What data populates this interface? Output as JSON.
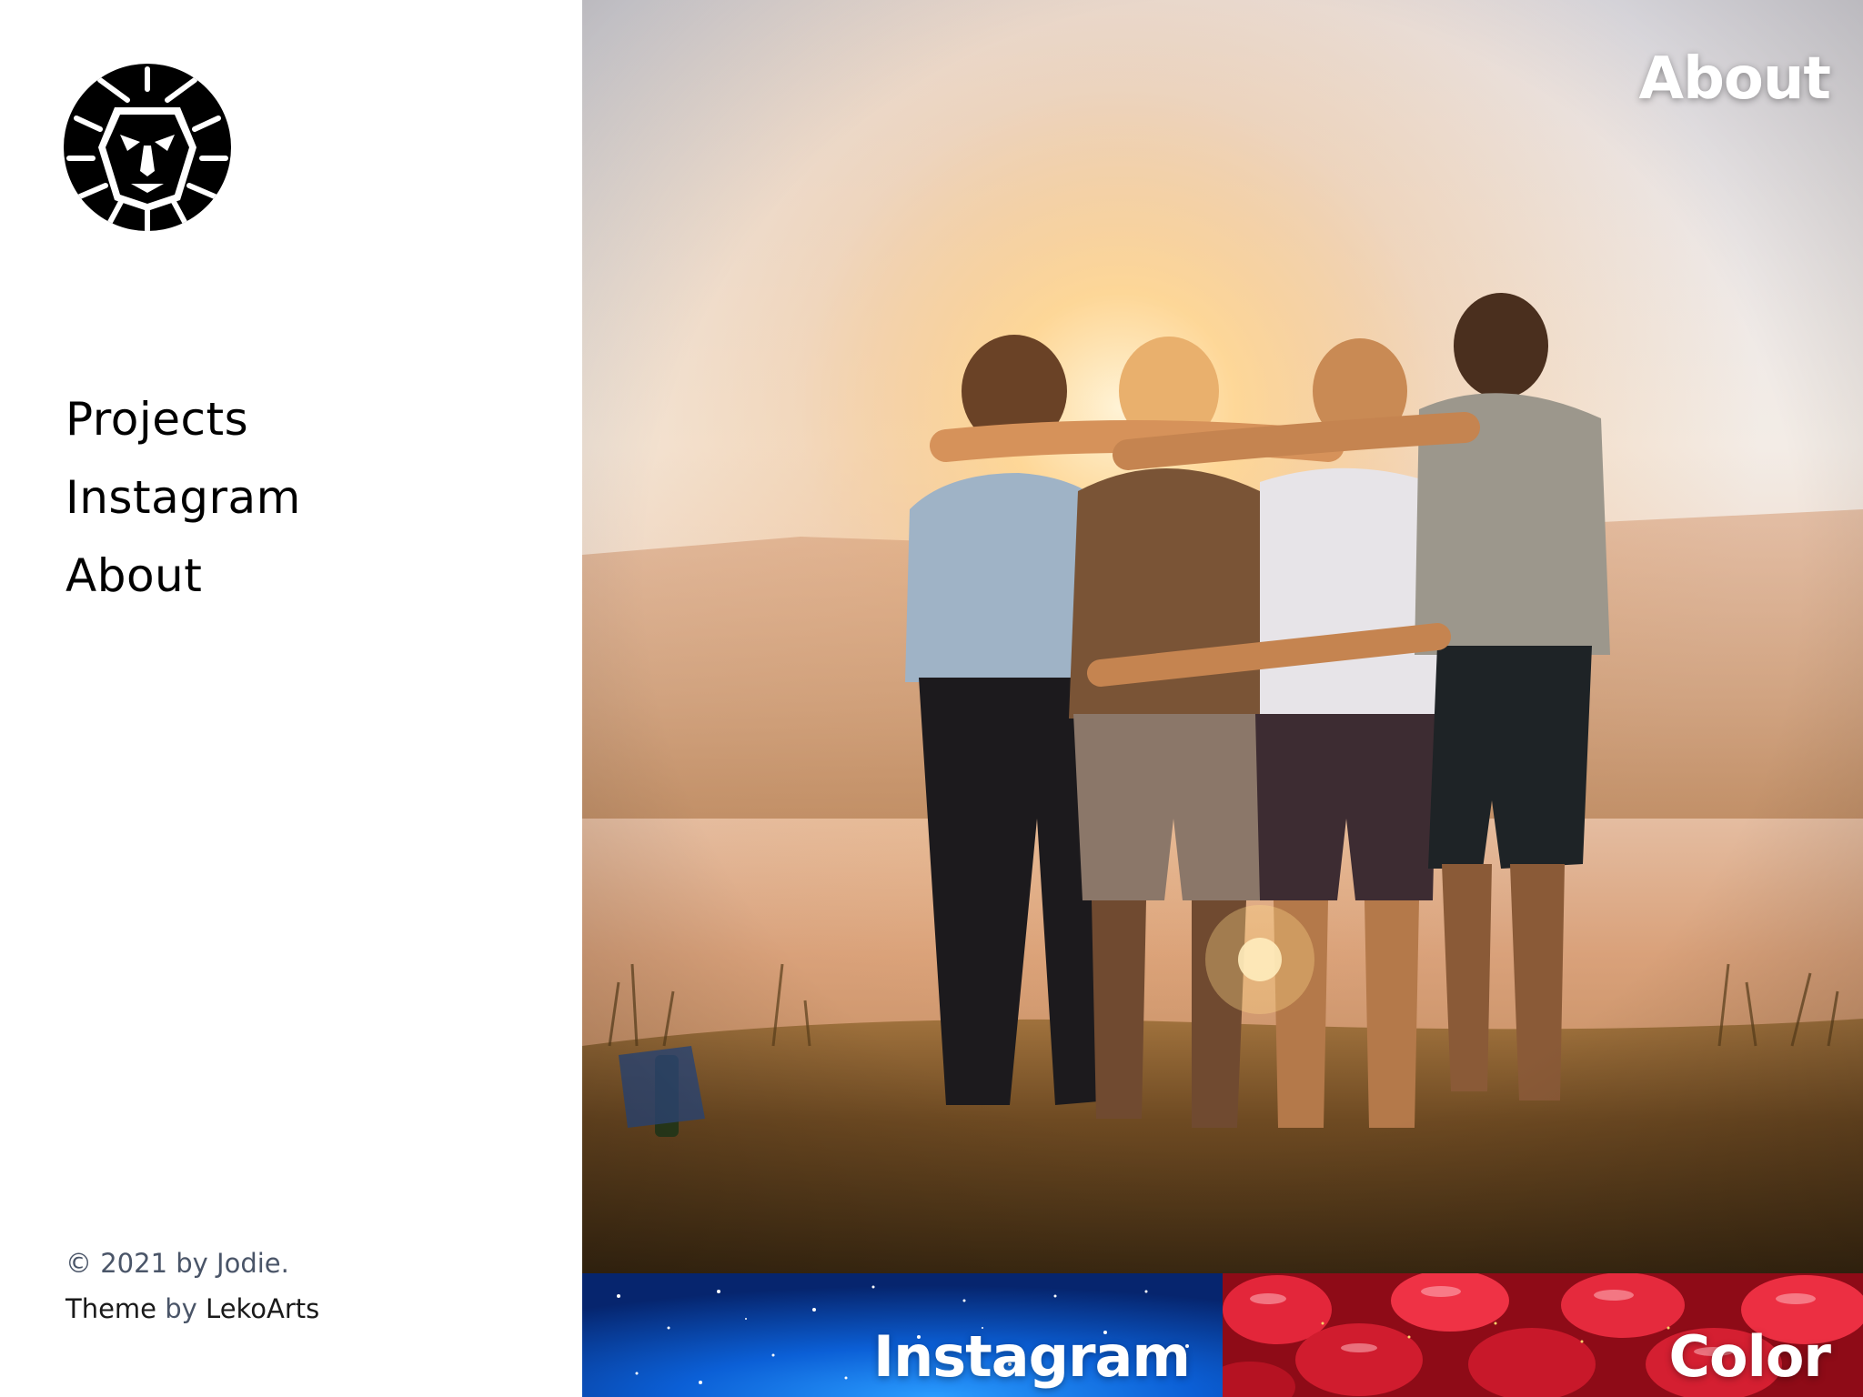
{
  "sidebar": {
    "logo_icon": "lion-head-icon",
    "nav": [
      {
        "label": "Projects"
      },
      {
        "label": "Instagram"
      },
      {
        "label": "About"
      }
    ],
    "footer": {
      "copyright": "© 2021 by Jodie.",
      "theme_prefix": "Theme",
      "theme_by": "by",
      "theme_author": "LekoArts"
    }
  },
  "hero": {
    "title": "About",
    "image": "friends-hugging-at-sunset-photo"
  },
  "tiles": [
    {
      "title": "Instagram",
      "image": "blue-starry-background",
      "accent": "#0b4fb3"
    },
    {
      "title": "Color",
      "image": "red-peppers-closeup",
      "accent": "#d31a2b"
    }
  ]
}
